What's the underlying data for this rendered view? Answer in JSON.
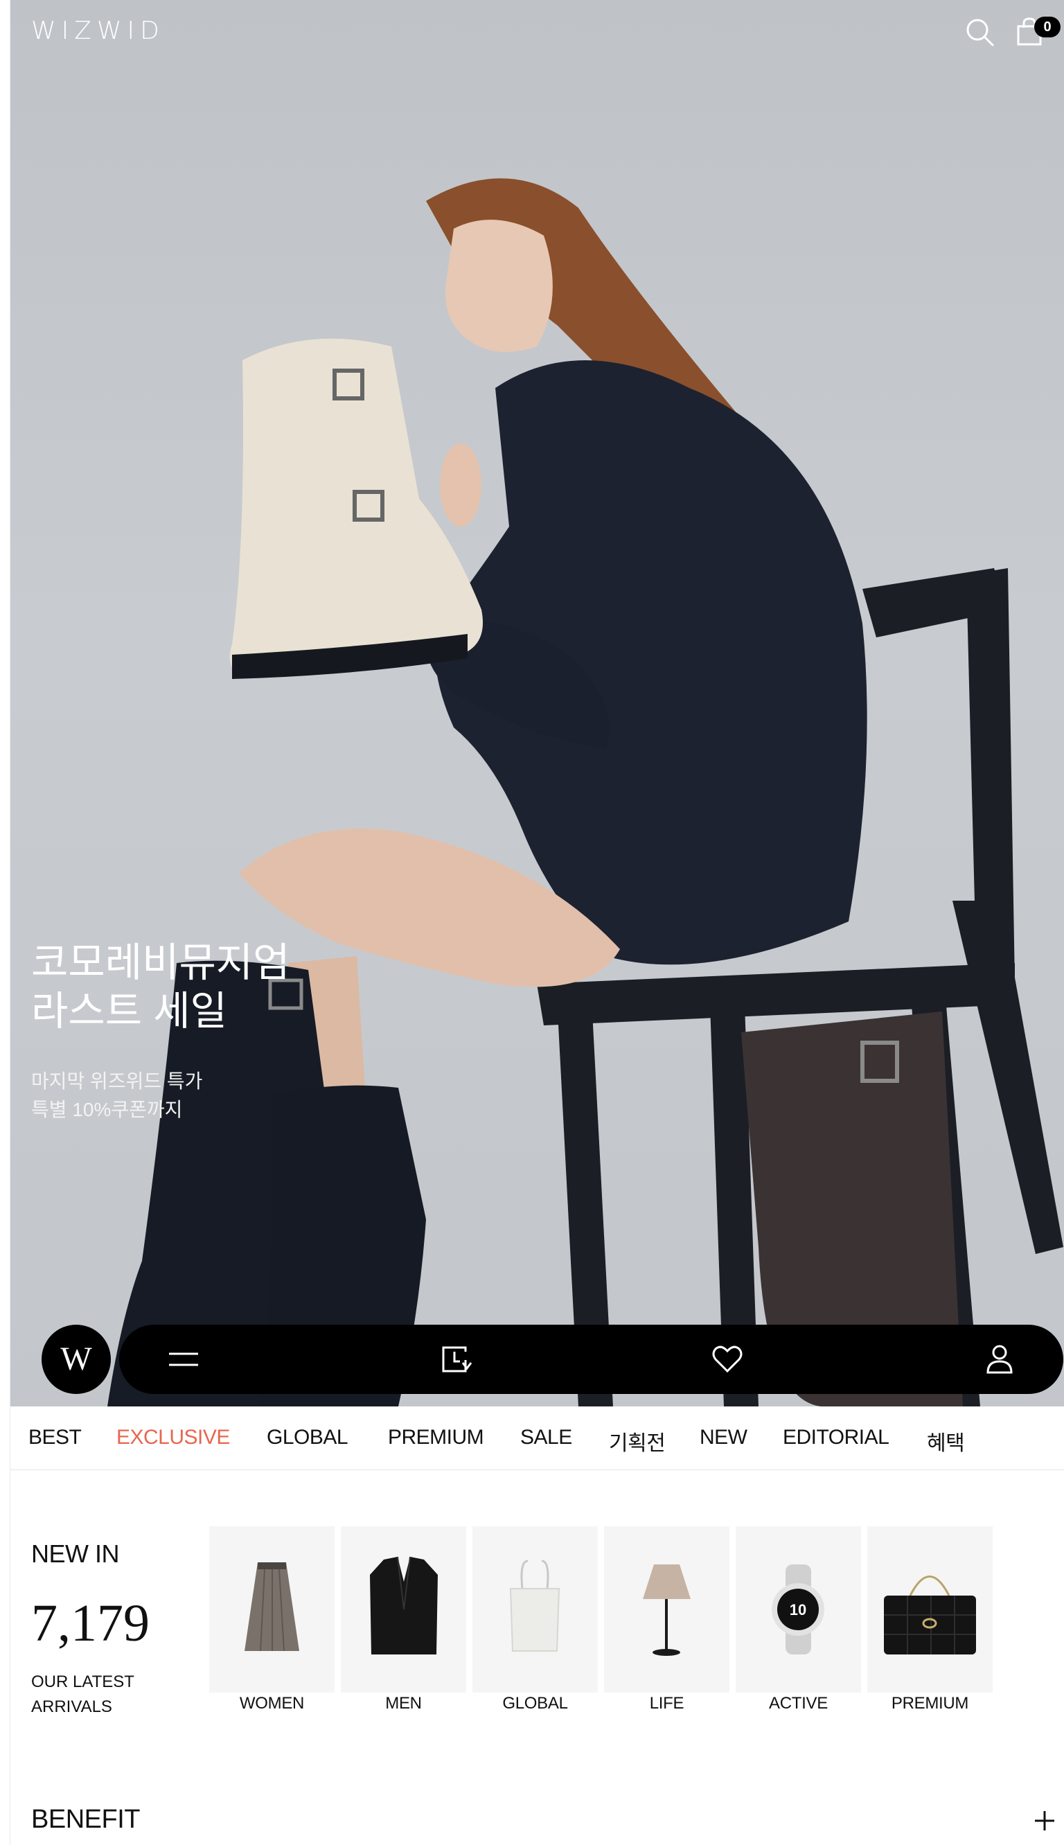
{
  "header": {
    "logo": "WIZWID",
    "cart_count": "0"
  },
  "hero": {
    "title_lines": [
      "코모레비뮤지엄",
      "라스트 세일"
    ],
    "subtitle_lines": [
      "마지막 위즈위드 특가",
      "특별 10%쿠폰까지"
    ]
  },
  "bottom_bar": {
    "brand_button": "W"
  },
  "categories": [
    {
      "label": "BEST",
      "active": false
    },
    {
      "label": "EXCLUSIVE",
      "active": true
    },
    {
      "label": "GLOBAL",
      "active": false
    },
    {
      "label": "PREMIUM",
      "active": false
    },
    {
      "label": "SALE",
      "active": false
    },
    {
      "label": "기획전",
      "active": false
    },
    {
      "label": "NEW",
      "active": false
    },
    {
      "label": "EDITORIAL",
      "active": false
    },
    {
      "label": "혜택",
      "active": false
    }
  ],
  "new_in": {
    "label": "NEW IN",
    "count": "7,179",
    "sub_lines": [
      "OUR LATEST",
      "ARRIVALS"
    ],
    "tiles": [
      {
        "label": "WOMEN",
        "icon": "skirt-icon"
      },
      {
        "label": "MEN",
        "icon": "blazer-icon"
      },
      {
        "label": "GLOBAL",
        "icon": "tote-bag-icon"
      },
      {
        "label": "LIFE",
        "icon": "lamp-icon"
      },
      {
        "label": "ACTIVE",
        "icon": "smartwatch-icon"
      },
      {
        "label": "PREMIUM",
        "icon": "quilted-bag-icon"
      }
    ]
  },
  "benefit": {
    "label": "BENEFIT"
  },
  "colors": {
    "accent": "#e8664e",
    "bar": "#000000",
    "hero_bg": "#c5c9cd"
  }
}
